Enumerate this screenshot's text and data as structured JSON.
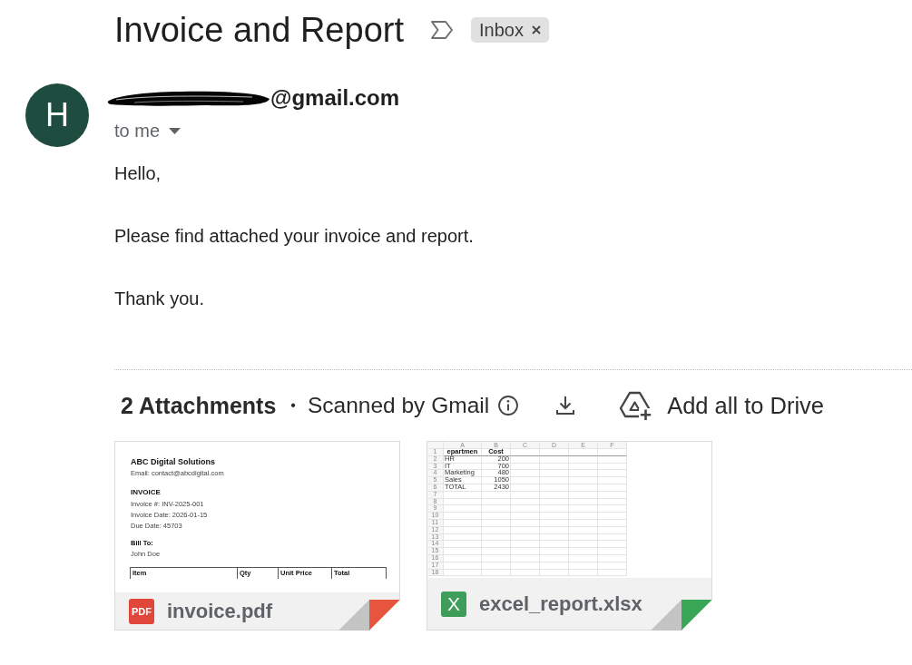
{
  "subject": "Invoice and Report",
  "important": false,
  "labels": [
    {
      "text": "Inbox"
    }
  ],
  "sender": {
    "initial": "H",
    "redacted": true,
    "email": "@gmail.com"
  },
  "recipient": "to me",
  "body": [
    "Hello,",
    "Please find attached your invoice and report.",
    "Thank you."
  ],
  "attachments_bar": {
    "count": "2 Attachments",
    "separator": "•",
    "scan_note": "Scanned by Gmail",
    "add_all": "Add all to Drive"
  },
  "attachments": [
    {
      "kind": "pdf",
      "type_label": "PDF",
      "name": "invoice.pdf",
      "preview": {
        "kind": "document",
        "company": "ABC Digital Solutions",
        "contact": "Email: contact@abcdigital.com",
        "heading": "INVOICE",
        "details": [
          "Invoice #: INV-2025-001",
          "Invoice Date: 2026-01-15",
          "Due Date: 45703"
        ],
        "bill_to_label": "Bill To:",
        "bill_to": "John Doe",
        "table_columns": [
          "Item",
          "Qty",
          "Unit Price",
          "Total"
        ]
      }
    },
    {
      "kind": "xlsx",
      "type_label": "X",
      "name": "excel_report.xlsx",
      "preview": {
        "kind": "spreadsheet",
        "column_headers": [
          "A",
          "B",
          "C",
          "D",
          "E",
          "F"
        ],
        "rows": [
          {
            "number": "1",
            "cells": [
              "epartmen",
              "Cost"
            ],
            "bold": true
          },
          {
            "number": "2",
            "cells": [
              "HR",
              "200"
            ],
            "bold": false
          },
          {
            "number": "3",
            "cells": [
              "IT",
              "700"
            ],
            "bold": false
          },
          {
            "number": "4",
            "cells": [
              "Marketing",
              "480"
            ],
            "bold": false
          },
          {
            "number": "5",
            "cells": [
              "Sales",
              "1050"
            ],
            "bold": false
          },
          {
            "number": "6",
            "cells": [
              "TOTAL",
              "2430"
            ],
            "bold": false
          }
        ],
        "empty_rows": [
          "7",
          "8",
          "9",
          "10",
          "11",
          "12",
          "13",
          "14",
          "15",
          "16",
          "17",
          "18"
        ]
      }
    }
  ]
}
